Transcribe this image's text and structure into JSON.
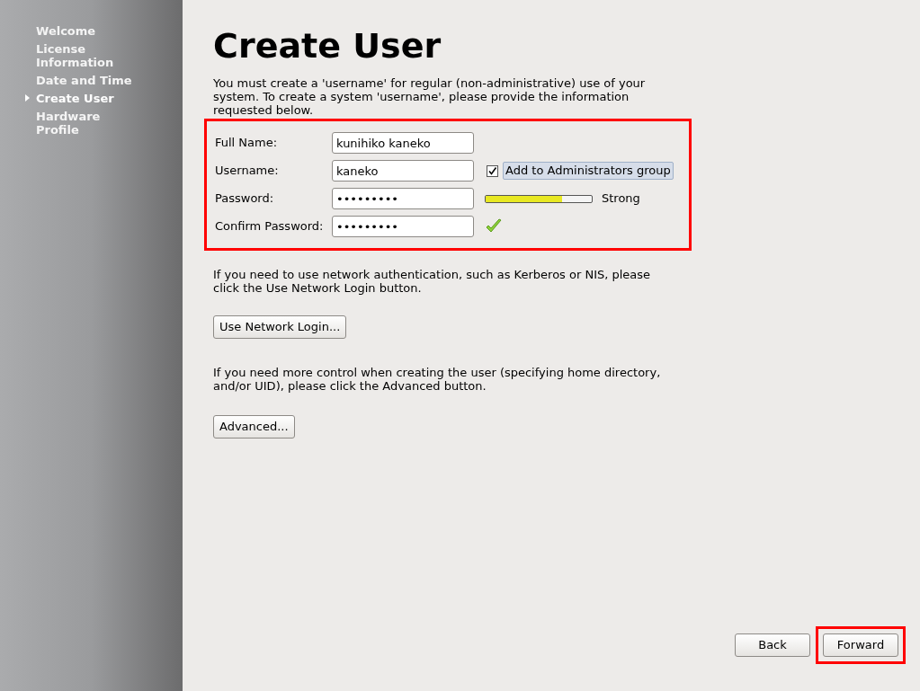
{
  "sidebar": {
    "items": [
      {
        "label": "Welcome",
        "selected": false
      },
      {
        "label": "License Information",
        "selected": false
      },
      {
        "label": "Date and Time",
        "selected": false
      },
      {
        "label": "Create User",
        "selected": true
      },
      {
        "label": "Hardware Profile",
        "selected": false
      }
    ]
  },
  "title": "Create User",
  "intro": "You must create a 'username' for regular (non-administrative) use of your system.  To create a system 'username', please provide the information requested below.",
  "form": {
    "highlighted": true,
    "full_name": {
      "label": "Full Name:",
      "value": "kunihiko kaneko"
    },
    "username": {
      "label": "Username:",
      "value": "kaneko"
    },
    "admin_checkbox": {
      "label": "Add to Administrators group",
      "checked": true
    },
    "password": {
      "label": "Password:",
      "value": "•••••••••"
    },
    "strength": {
      "level": 0.72,
      "reading": "Strong"
    },
    "confirm": {
      "label": "Confirm Password:",
      "value": "•••••••••",
      "matches": true
    }
  },
  "network_note": "If you need to use network authentication, such as Kerberos or NIS, please click the Use Network Login button.",
  "network_button": "Use Network Login...",
  "advanced_note": "If you need more control when creating the user (specifying home directory, and/or UID), please click the Advanced button.",
  "advanced_button": "Advanced...",
  "footer": {
    "back": "Back",
    "forward": "Forward",
    "forward_highlighted": true
  }
}
